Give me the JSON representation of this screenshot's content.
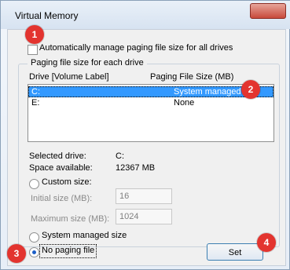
{
  "window": {
    "title": "Virtual Memory"
  },
  "auto_manage": {
    "label": "Automatically manage paging file size for all drives"
  },
  "group": {
    "title": "Paging file size for each drive"
  },
  "list": {
    "headers": [
      "Drive  [Volume Label]",
      "Paging File Size (MB)"
    ],
    "rows": [
      {
        "drive": "C:",
        "size": "System managed",
        "selected": true
      },
      {
        "drive": "E:",
        "size": "None",
        "selected": false
      }
    ]
  },
  "details": {
    "selected_drive_label": "Selected drive:",
    "selected_drive_value": "C:",
    "space_available_label": "Space available:",
    "space_available_value": "12367 MB"
  },
  "custom_size": {
    "label": "Custom size:",
    "initial_label": "Initial size (MB):",
    "initial_value": "16",
    "maximum_label": "Maximum size (MB):",
    "maximum_value": "1024"
  },
  "system_managed": {
    "label": "System managed size"
  },
  "no_paging": {
    "label": "No paging file"
  },
  "set_button": {
    "label": "Set"
  },
  "annotations": [
    "1",
    "2",
    "3",
    "4"
  ],
  "colors": {
    "selection": "#3399ff",
    "badge": "#e3342f",
    "accent_border": "#3c7fb1"
  }
}
